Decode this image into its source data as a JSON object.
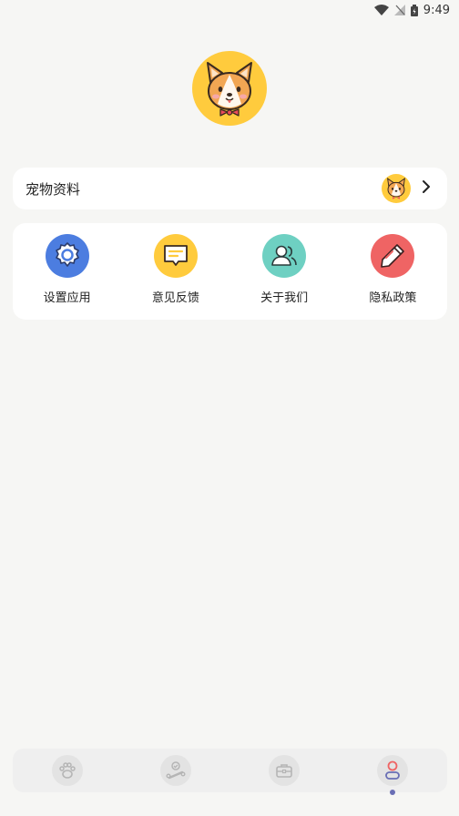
{
  "status_bar": {
    "time": "9:49"
  },
  "profile": {
    "avatar_icon": "corgi-avatar-icon"
  },
  "pet_card": {
    "label": "宠物资料",
    "chevron_icon": "chevron-right-icon"
  },
  "menu": [
    {
      "label": "设置应用",
      "icon": "gear-icon",
      "color": "#4c7de0"
    },
    {
      "label": "意见反馈",
      "icon": "message-icon",
      "color": "#ffcb3d"
    },
    {
      "label": "关于我们",
      "icon": "users-icon",
      "color": "#6ed0c2"
    },
    {
      "label": "隐私政策",
      "icon": "pencil-icon",
      "color": "#ef6464"
    }
  ],
  "tabbar": {
    "tabs": [
      "paw-icon",
      "bone-icon",
      "briefcase-icon",
      "profile-icon"
    ],
    "active_index": 3,
    "active_color": "#6a6fb5"
  }
}
